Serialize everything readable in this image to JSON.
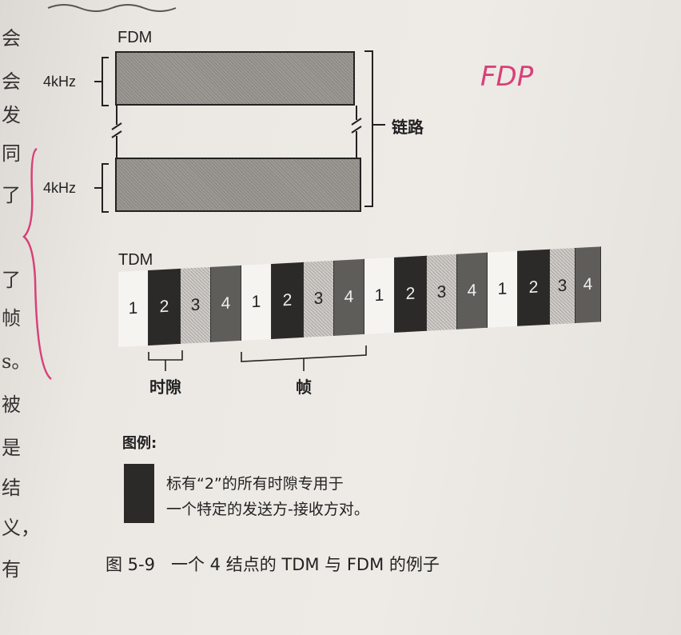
{
  "left_edge_chars": [
    "会",
    "会",
    "发",
    "同",
    "了",
    "了",
    "帧",
    "s。",
    "被",
    "是",
    "结",
    "义，",
    "有"
  ],
  "fdm": {
    "title": "FDM",
    "band1_label": "4kHz",
    "band2_label": "4kHz",
    "link_label": "链路"
  },
  "tdm": {
    "title": "TDM",
    "slots": [
      "1",
      "2",
      "3",
      "4",
      "1",
      "2",
      "3",
      "4",
      "1",
      "2",
      "3",
      "4",
      "1",
      "2",
      "3",
      "4"
    ],
    "timeslot_label": "时隙",
    "frame_label": "帧"
  },
  "legend": {
    "title": "图例:",
    "line1": "标有“2”的所有时隙专用于",
    "line2": "一个特定的发送方-接收方对。"
  },
  "caption": "图 5-9   一个 4 结点的 TDM 与 FDM 的例子",
  "handwritten_note": "FDP",
  "colors": {
    "annotation_ink": "#d8407a"
  }
}
